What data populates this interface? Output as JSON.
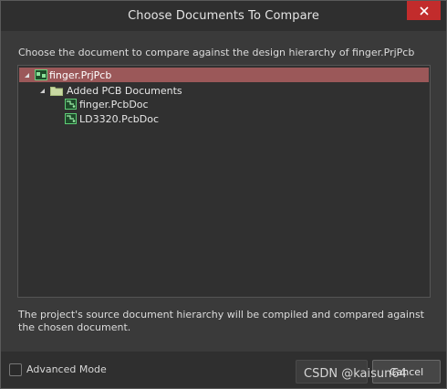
{
  "dialog": {
    "title": "Choose Documents To Compare",
    "instruction": "Choose the document to compare against the design hierarchy of finger.PrjPcb",
    "footer_text": "The project's source document hierarchy will be compiled and compared against the chosen document."
  },
  "tree": {
    "root": {
      "label": "finger.PrjPcb",
      "icon": "pcb-project-icon",
      "expanded": true,
      "selected": true
    },
    "folder": {
      "label": "Added PCB Documents",
      "icon": "folder-icon",
      "expanded": true
    },
    "documents": [
      {
        "label": "finger.PcbDoc",
        "icon": "pcb-document-icon"
      },
      {
        "label": "LD3320.PcbDoc",
        "icon": "pcb-document-icon"
      }
    ]
  },
  "bottom": {
    "advanced_mode_label": "Advanced Mode",
    "advanced_mode_checked": false,
    "ok_label": "",
    "cancel_label": "Cancel"
  },
  "watermark": "CSDN @kaisun64",
  "colors": {
    "selection": "#9b5859",
    "close_button": "#c22c2c",
    "background": "#3a3a3a"
  }
}
